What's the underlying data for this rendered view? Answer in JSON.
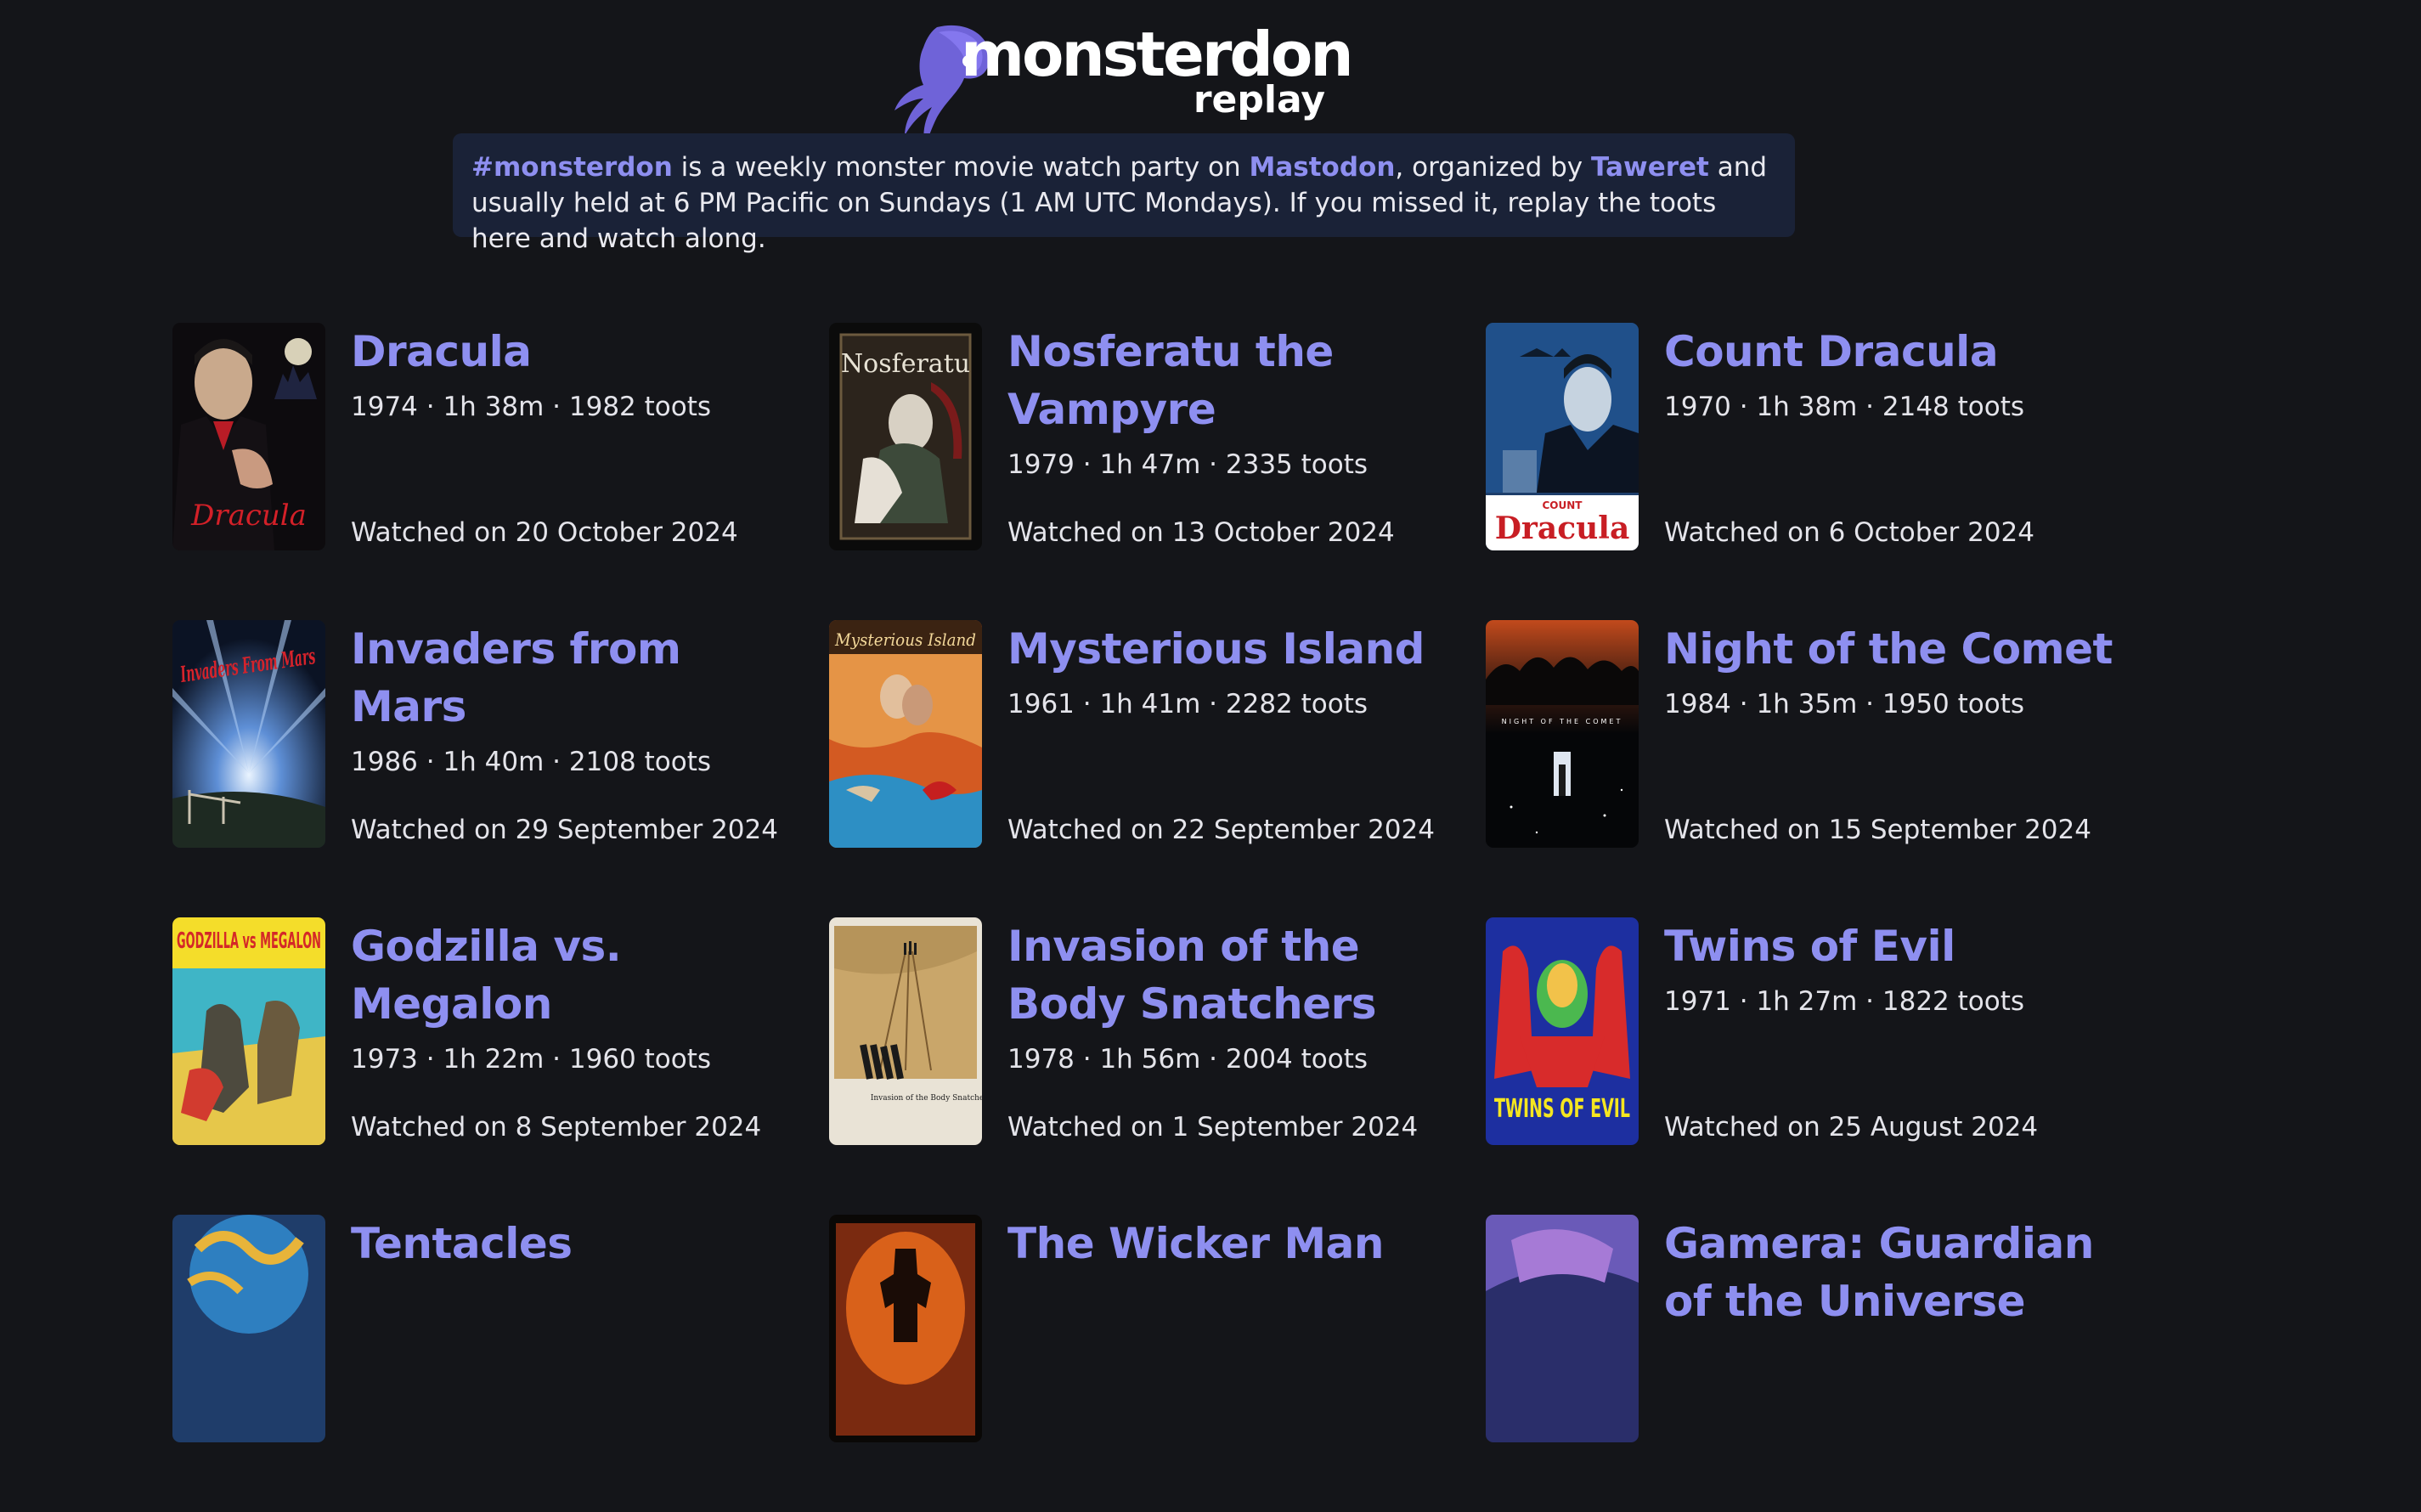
{
  "header": {
    "logo_word": "monsterdon",
    "logo_sub": "replay"
  },
  "intro": {
    "hashtag": "#monsterdon",
    "text1": " is a weekly monster movie watch party on ",
    "mastodon": "Mastodon",
    "text2": ", organized by ",
    "organizer": "Taweret",
    "text3": " and usually held at 6 PM Pacific on Sundays (1 AM UTC Mondays). If you missed it, replay the toots here and watch along."
  },
  "colors": {
    "background": "#141519",
    "accent": "#8e8ff0",
    "intro_bg": "#1a2237"
  },
  "movies": [
    {
      "title": "Dracula",
      "meta": "1974 · 1h 38m · 1982 toots",
      "watched": "Watched on 20 October 2024",
      "poster_text": "Dracula",
      "poster_icon": "dracula-poster"
    },
    {
      "title": "Nosferatu the Vampyre",
      "meta": "1979 · 1h 47m · 2335 toots",
      "watched": "Watched on 13 October 2024",
      "poster_text": "Nosferatu",
      "poster_icon": "nosferatu-poster"
    },
    {
      "title": "Count Dracula",
      "meta": "1970 · 1h 38m · 2148 toots",
      "watched": "Watched on 6 October 2024",
      "poster_text": "Dracula",
      "poster_icon": "count-dracula-poster"
    },
    {
      "title": "Invaders from Mars",
      "meta": "1986 · 1h 40m · 2108 toots",
      "watched": "Watched on 29 September 2024",
      "poster_text": "Invaders From Mars",
      "poster_icon": "invaders-poster"
    },
    {
      "title": "Mysterious Island",
      "meta": "1961 · 1h 41m · 2282 toots",
      "watched": "Watched on 22 September 2024",
      "poster_text": "Mysterious Island",
      "poster_icon": "mysterious-island-poster"
    },
    {
      "title": "Night of the Comet",
      "meta": "1984 · 1h 35m · 1950 toots",
      "watched": "Watched on 15 September 2024",
      "poster_text": "NIGHT OF THE COMET",
      "poster_icon": "comet-poster"
    },
    {
      "title": "Godzilla vs. Megalon",
      "meta": "1973 · 1h 22m · 1960 toots",
      "watched": "Watched on 8 September 2024",
      "poster_text": "GODZILLA vs MEGALON",
      "poster_icon": "godzilla-poster"
    },
    {
      "title": "Invasion of the Body Snatchers",
      "meta": "1978 · 1h 56m · 2004 toots",
      "watched": "Watched on 1 September 2024",
      "poster_text": "Invasion of the Body Snatchers",
      "poster_icon": "body-snatchers-poster"
    },
    {
      "title": "Twins of Evil",
      "meta": "1971 · 1h 27m · 1822 toots",
      "watched": "Watched on 25 August 2024",
      "poster_text": "TWINS OF EVIL",
      "poster_icon": "twins-poster"
    },
    {
      "title": "Tentacles",
      "meta": "",
      "watched": "",
      "poster_text": "",
      "poster_icon": "tentacles-poster"
    },
    {
      "title": "The Wicker Man",
      "meta": "",
      "watched": "",
      "poster_text": "",
      "poster_icon": "wicker-man-poster"
    },
    {
      "title": "Gamera: Guardian of the Universe",
      "meta": "",
      "watched": "",
      "poster_text": "",
      "poster_icon": "gamera-poster"
    }
  ]
}
